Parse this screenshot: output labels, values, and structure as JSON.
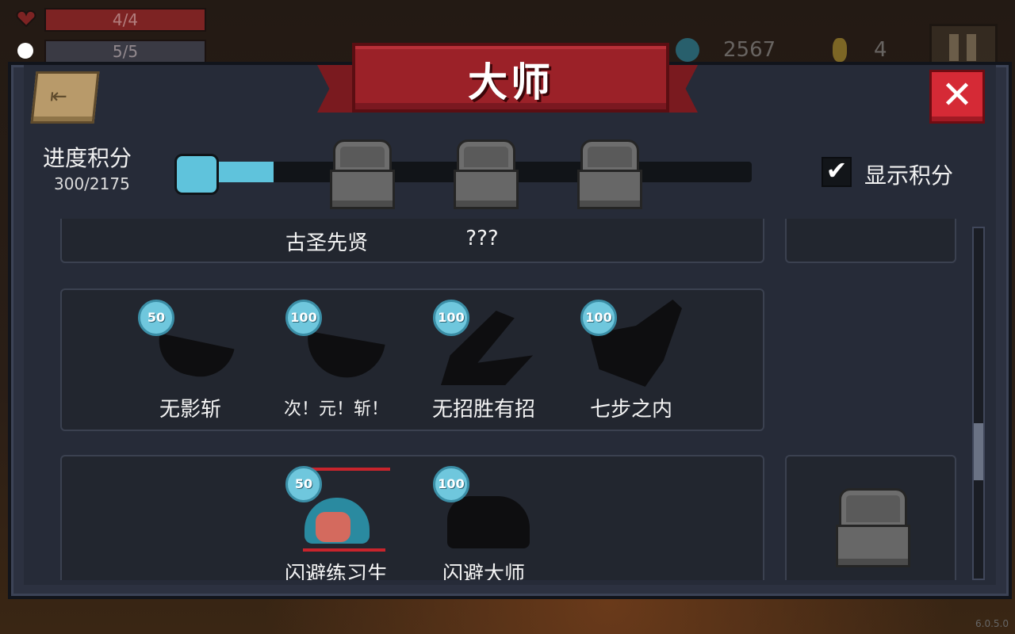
{
  "hud": {
    "health": "4/4",
    "energy": "5/5",
    "gems": "2567",
    "keys": "4"
  },
  "modal": {
    "title": "大师",
    "progress_label": "进度积分",
    "progress_value": "300/2175",
    "progress_fraction": 0.138,
    "show_points_label": "显示积分",
    "show_points_checked": true
  },
  "rows": [
    {
      "items": [
        {
          "name": "古圣先贤"
        },
        {
          "name": "???"
        }
      ]
    },
    {
      "items": [
        {
          "name": "无影斩",
          "points": "50"
        },
        {
          "name": "次！元！斩！",
          "points": "100"
        },
        {
          "name": "无招胜有招",
          "points": "100"
        },
        {
          "name": "七步之内",
          "points": "100"
        }
      ]
    },
    {
      "items": [
        {
          "name": "闪避练习生",
          "points": "50"
        },
        {
          "name": "闪避大师",
          "points": "100"
        }
      ]
    }
  ],
  "colors": {
    "accent": "#5fc3dc",
    "ribbon": "#9b2128",
    "close": "#d52a36",
    "panel": "#2c3140"
  },
  "version": "6.0.5.0"
}
